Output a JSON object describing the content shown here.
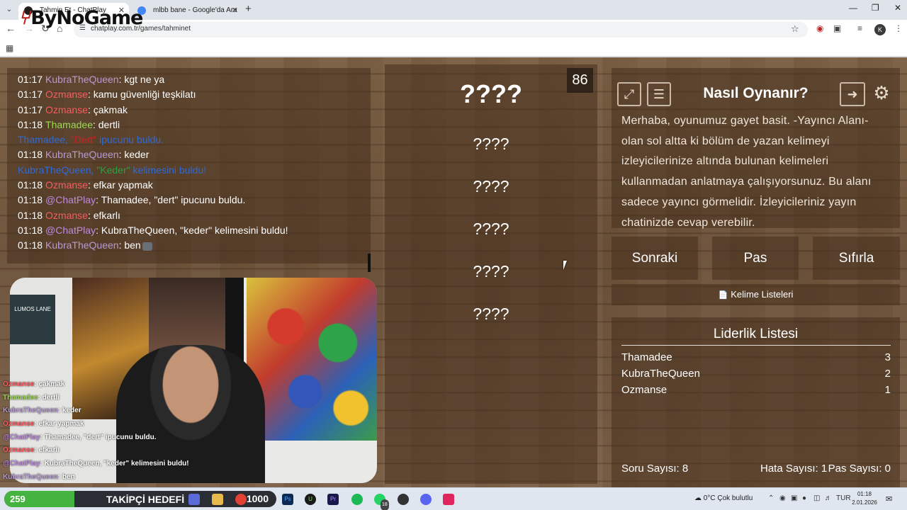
{
  "browser": {
    "tabs": [
      {
        "title": "Tahmin Et - ChatPlay",
        "active": true
      },
      {
        "title": "mlbb bane - Google'da Ara",
        "active": false
      }
    ],
    "url": "chatplay.com.tr/games/tahminet",
    "profile_initial": "K",
    "extension_badge": "2"
  },
  "logo": {
    "text": "ByNoGame",
    "mark": "⑂"
  },
  "chat": {
    "messages": [
      {
        "time": "01:17",
        "user": "KubraTheQueen",
        "color": "#b79ad3",
        "text": "kgt ne ya"
      },
      {
        "time": "01:17",
        "user": "Ozmanse",
        "color": "#ff5a5f",
        "text": "kamu güvenliği teşkilatı"
      },
      {
        "time": "01:17",
        "user": "Ozmanse",
        "color": "#ff5a5f",
        "text": "çakmak"
      },
      {
        "time": "01:18",
        "user": "Thamadee",
        "color": "#9bdb4f",
        "text": "dertli"
      },
      {
        "time": "01:18",
        "user": "KubraTheQueen",
        "color": "#b79ad3",
        "text": "keder"
      },
      {
        "time": "01:18",
        "user": "Ozmanse",
        "color": "#ff5a5f",
        "text": "efkar yapmak"
      },
      {
        "time": "01:18",
        "user": "@ChatPlay",
        "color": "#c08ae0",
        "text": "Thamadee, \"dert\" ipucunu buldu."
      },
      {
        "time": "01:18",
        "user": "Ozmanse",
        "color": "#ff5a5f",
        "text": "efkarlı"
      },
      {
        "time": "01:18",
        "user": "@ChatPlay",
        "color": "#c08ae0",
        "text": "KubraTheQueen, \"keder\" kelimesini buldu!"
      },
      {
        "time": "01:18",
        "user": "KubraTheQueen",
        "color": "#b79ad3",
        "text": "ben"
      }
    ],
    "notices": [
      {
        "user": "Thamadee,",
        "word": "\"Dert\"",
        "rest": "ipucunu buldu."
      },
      {
        "user": "KubraTheQueen,",
        "word": "\"Keder\"",
        "rest": "kelimesini buldu!"
      }
    ]
  },
  "stream_overlay": {
    "lines": [
      {
        "user": "Ozmanse",
        "color": "#ff5a5f",
        "text": ": çakmak"
      },
      {
        "user": "Thamadee",
        "color": "#9bdb4f",
        "text": ": dertli"
      },
      {
        "user": "KubraTheQueen",
        "color": "#b79ad3",
        "text": ": keder"
      },
      {
        "user": "Ozmanse",
        "color": "#ff5a5f",
        "text": ": efkar yapmak"
      },
      {
        "user": "@ChatPlay",
        "color": "#c08ae0",
        "text": ": Thamadee, \"dert\" ipucunu buldu."
      },
      {
        "user": "Ozmanse",
        "color": "#ff5a5f",
        "text": ": efkarlı"
      },
      {
        "user": "@ChatPlay",
        "color": "#c08ae0",
        "text": ": KubraTheQueen, \"keder\" kelimesini buldu!"
      },
      {
        "user": "KubraTheQueen",
        "color": "#b79ad3",
        "text": ": ben"
      }
    ],
    "poster_text": "LUMOS LANE"
  },
  "game": {
    "timer": "86",
    "main_word": "????",
    "hidden_words": [
      "????",
      "????",
      "????",
      "????",
      "????"
    ]
  },
  "howto": {
    "title": "Nasıl Oynanır?",
    "description": "Merhaba, oyunumuz gayet basit. -Yayıncı Alanı- olan sol altta ki bölüm de yazan kelimeyi izleyicilerinize altında bulunan kelimeleri kullanmadan anlatmaya çalışıyorsunuz. Bu alanı sadece yayıncı görmelidir. İzleyicileriniz yayın chatinizde cevap verebilir."
  },
  "buttons": {
    "next": "Sonraki",
    "pass": "Pas",
    "reset": "Sıfırla",
    "word_lists": "Kelime Listeleri"
  },
  "leaderboard": {
    "title": "Liderlik Listesi",
    "rows": [
      {
        "name": "Thamadee",
        "score": "3"
      },
      {
        "name": "KubraTheQueen",
        "score": "2"
      },
      {
        "name": "Ozmanse",
        "score": "1"
      }
    ],
    "stats": {
      "questions": "Soru Sayısı: 8",
      "errors": "Hata Sayısı: 1",
      "passes": "Pas Sayısı: 0"
    }
  },
  "follower_goal": {
    "current": "259",
    "label": "TAKİPÇİ HEDEFİ",
    "target": "1000",
    "progress_fraction": 0.259
  },
  "taskbar": {
    "weather": "0°C  Çok bulutlu",
    "language": "TUR",
    "time": "01:18",
    "date": "2.01.2026",
    "whatsapp_badge": "18"
  }
}
